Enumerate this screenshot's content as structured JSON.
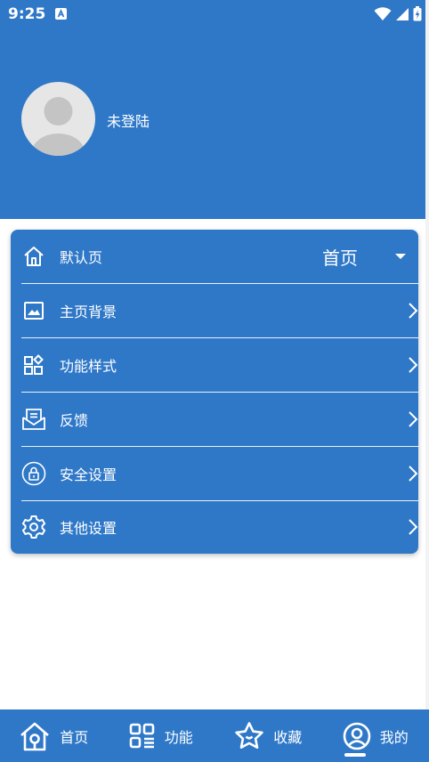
{
  "status_bar": {
    "time": "9:25"
  },
  "profile": {
    "login_status": "未登陆"
  },
  "settings": {
    "default_page": {
      "label": "默认页",
      "value": "首页"
    },
    "items": [
      {
        "label": "主页背景",
        "icon": "image-icon"
      },
      {
        "label": "功能样式",
        "icon": "widgets-icon"
      },
      {
        "label": "反馈",
        "icon": "mail-icon"
      },
      {
        "label": "安全设置",
        "icon": "lock-icon"
      },
      {
        "label": "其他设置",
        "icon": "gear-icon"
      }
    ]
  },
  "bottom_nav": [
    {
      "label": "首页",
      "icon": "home-icon"
    },
    {
      "label": "功能",
      "icon": "grid-icon"
    },
    {
      "label": "收藏",
      "icon": "star-icon"
    },
    {
      "label": "我的",
      "icon": "user-icon",
      "active": true
    }
  ],
  "colors": {
    "primary": "#2f78c8",
    "surface": "#ffffff"
  }
}
